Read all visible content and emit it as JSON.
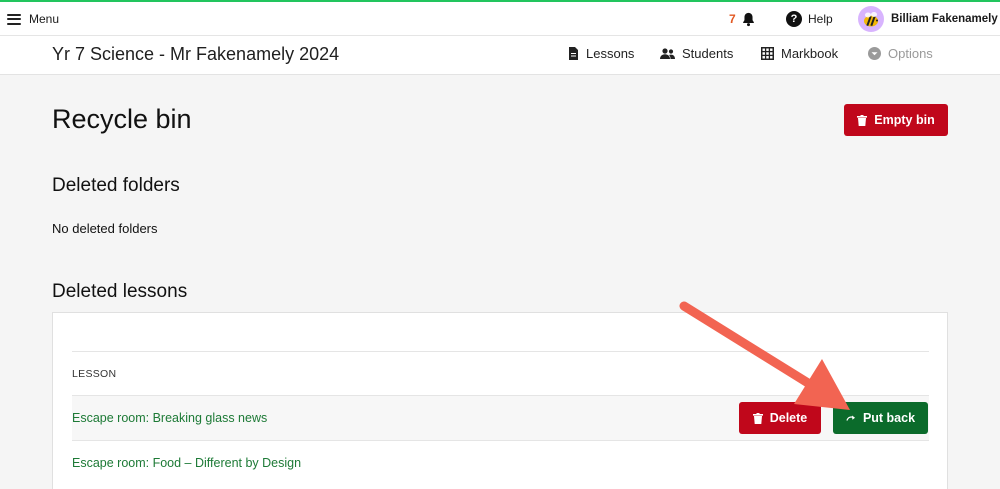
{
  "topbar": {
    "menu_label": "Menu",
    "notification_count": "7",
    "help_label": "Help",
    "user_name": "Billiam Fakenamely"
  },
  "classbar": {
    "title": "Yr 7 Science - Mr Fakenamely 2024",
    "nav": [
      {
        "label": "Lessons",
        "icon": "document-icon"
      },
      {
        "label": "Students",
        "icon": "users-icon"
      },
      {
        "label": "Markbook",
        "icon": "grid-icon"
      },
      {
        "label": "Options",
        "icon": "chevron-down-circle-icon",
        "disabled": true
      }
    ]
  },
  "page": {
    "title": "Recycle bin",
    "empty_bin_label": "Empty bin"
  },
  "folders": {
    "heading": "Deleted folders",
    "empty_message": "No deleted folders"
  },
  "lessons": {
    "heading": "Deleted lessons",
    "column_header": "LESSON",
    "rows": [
      {
        "title": "Escape room: Breaking glass news",
        "delete_label": "Delete",
        "putback_label": "Put back"
      },
      {
        "title": "Escape room: Food – Different by Design"
      }
    ]
  },
  "colors": {
    "accent_green": "#22c55e",
    "danger": "#c0071b",
    "success": "#0b6b2b",
    "link_green": "#1d7a36",
    "annotation_arrow": "#f26452"
  }
}
